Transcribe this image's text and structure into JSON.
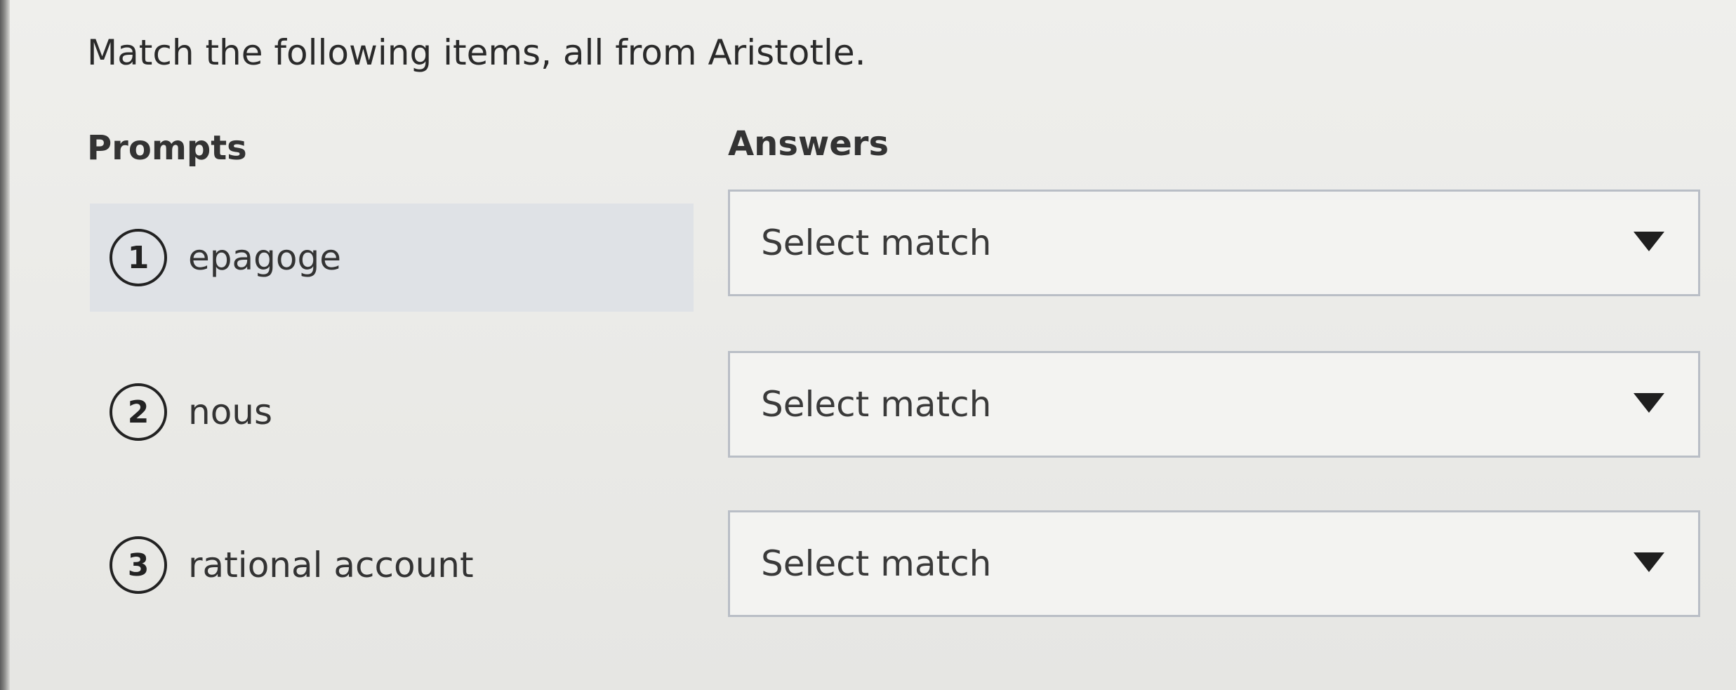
{
  "question": "Match the following items, all from Aristotle.",
  "headers": {
    "prompts": "Prompts",
    "answers": "Answers"
  },
  "rows": [
    {
      "number": "1",
      "prompt": "epagoge",
      "answer": "Select match"
    },
    {
      "number": "2",
      "prompt": "nous",
      "answer": "Select match"
    },
    {
      "number": "3",
      "prompt": "rational account",
      "answer": "Select match"
    }
  ],
  "icons": {
    "dropdown": "caret-down-icon"
  },
  "colors": {
    "page_background": "#e9e9e6",
    "highlight_row": "#dfe2e6",
    "select_border": "#b9bec6",
    "text": "#2b2b2b"
  }
}
